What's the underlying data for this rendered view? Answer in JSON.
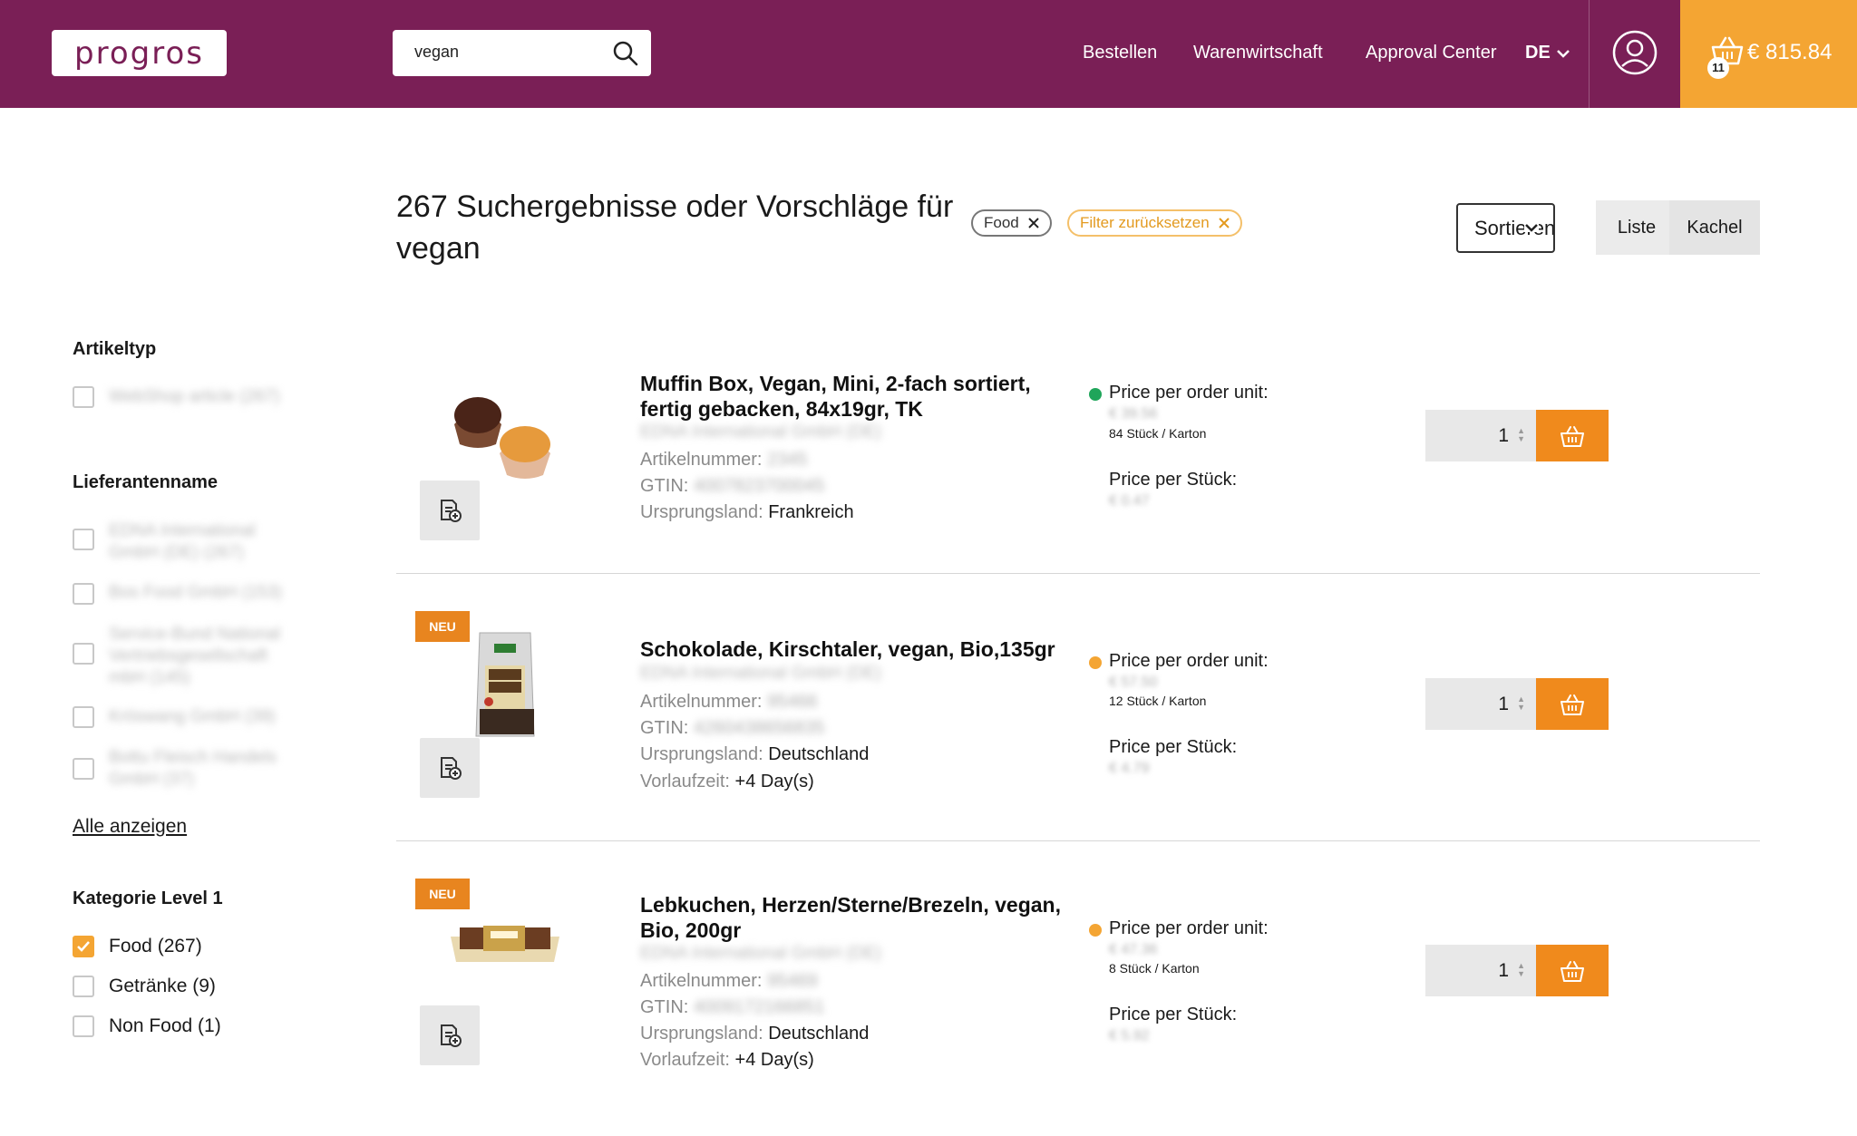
{
  "header": {
    "logo_text": "progros",
    "search_value": "vegan",
    "nav": [
      "Bestellen",
      "Warenwirtschaft",
      "Approval Center"
    ],
    "language": "DE",
    "cart_count": "11",
    "cart_total": "€ 815.84"
  },
  "results": {
    "title": "267 Suchergebnisse oder Vorschläge für vegan",
    "chip_filter": "Food",
    "chip_reset": "Filter zurücksetzen",
    "sort_label": "Sortieren",
    "view_list": "Liste",
    "view_tiles": "Kachel"
  },
  "sidebar": {
    "artikeltyp_heading": "Artikeltyp",
    "artikeltyp_option": "WebShop article (267)",
    "lieferant_heading": "Lieferantenname",
    "lieferant_options": [
      "EDNA International GmbH (DE) (267)",
      "Bos Food GmbH (153)",
      "Service-Bund National Vertriebsgesellschaft mbH (145)",
      "Kröswang GmbH (39)",
      "Bottu Fleisch Handels GmbH (37)"
    ],
    "show_all": "Alle anzeigen",
    "kategorie_heading": "Kategorie Level 1",
    "kategorie_options": [
      "Food (267)",
      "Getränke (9)",
      "Non Food (1)"
    ]
  },
  "labels": {
    "artikelnummer": "Artikelnummer:",
    "gtin": "GTIN:",
    "ursprungsland": "Ursprungsland:",
    "vorlaufzeit": "Vorlaufzeit:",
    "price_order_unit": "Price per order unit:",
    "price_piece": "Price per Stück:",
    "new_badge": "NEU"
  },
  "products": [
    {
      "name": "Muffin Box, Vegan, Mini, 2-fach sortiert, fertig gebacken, 84x19gr, TK",
      "supplier": "EDNA International GmbH (DE)",
      "artikelnummer": "2345",
      "gtin": "4007823700045",
      "ursprungsland": "Frankreich",
      "price_order_unit": "€ 39.56",
      "order_unit": "84 Stück / Karton",
      "price_piece": "€ 0.47",
      "quantity": "1",
      "status_color": "#1fa55a"
    },
    {
      "name": "Schokolade, Kirschtaler, vegan, Bio,135gr",
      "supplier": "EDNA International GmbH (DE)",
      "artikelnummer": "95466",
      "gtin": "4260438656835",
      "ursprungsland": "Deutschland",
      "vorlaufzeit": "+4 Day(s)",
      "price_order_unit": "€ 57.50",
      "order_unit": "12 Stück / Karton",
      "price_piece": "€ 4.79",
      "quantity": "1",
      "status_color": "#f4a533"
    },
    {
      "name": "Lebkuchen, Herzen/Sterne/Brezeln, vegan, Bio, 200gr",
      "supplier": "EDNA International GmbH (DE)",
      "artikelnummer": "95469",
      "gtin": "4009172166851",
      "ursprungsland": "Deutschland",
      "vorlaufzeit": "+4 Day(s)",
      "price_order_unit": "€ 47.36",
      "order_unit": "8 Stück / Karton",
      "price_piece": "€ 5.92",
      "quantity": "1",
      "status_color": "#f4a533"
    }
  ]
}
